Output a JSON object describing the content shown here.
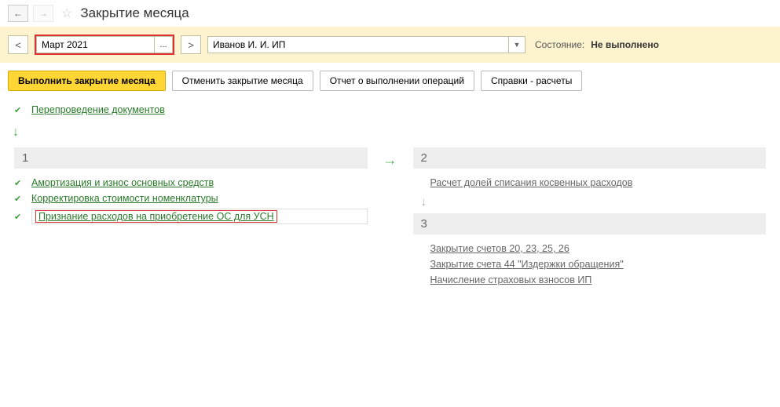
{
  "header": {
    "title": "Закрытие месяца"
  },
  "period": {
    "value": "Март 2021",
    "org": "Иванов И. И. ИП",
    "state_label": "Состояние:",
    "state_value": "Не выполнено"
  },
  "actions": {
    "execute": "Выполнить закрытие месяца",
    "cancel": "Отменить закрытие месяца",
    "report": "Отчет о выполнении операций",
    "refs": "Справки - расчеты"
  },
  "top_ops": {
    "reconduct": "Перепроведение документов"
  },
  "col1": {
    "num": "1",
    "op1": "Амортизация и износ основных средств",
    "op2": "Корректировка стоимости номенклатуры",
    "op3": "Признание расходов на приобретение ОС для УСН"
  },
  "col2": {
    "num": "2",
    "op1": "Расчет долей списания косвенных расходов"
  },
  "col3": {
    "num": "3",
    "op1": "Закрытие счетов 20, 23, 25, 26",
    "op2": "Закрытие счета 44 \"Издержки обращения\"",
    "op3": "Начисление страховых взносов ИП"
  }
}
